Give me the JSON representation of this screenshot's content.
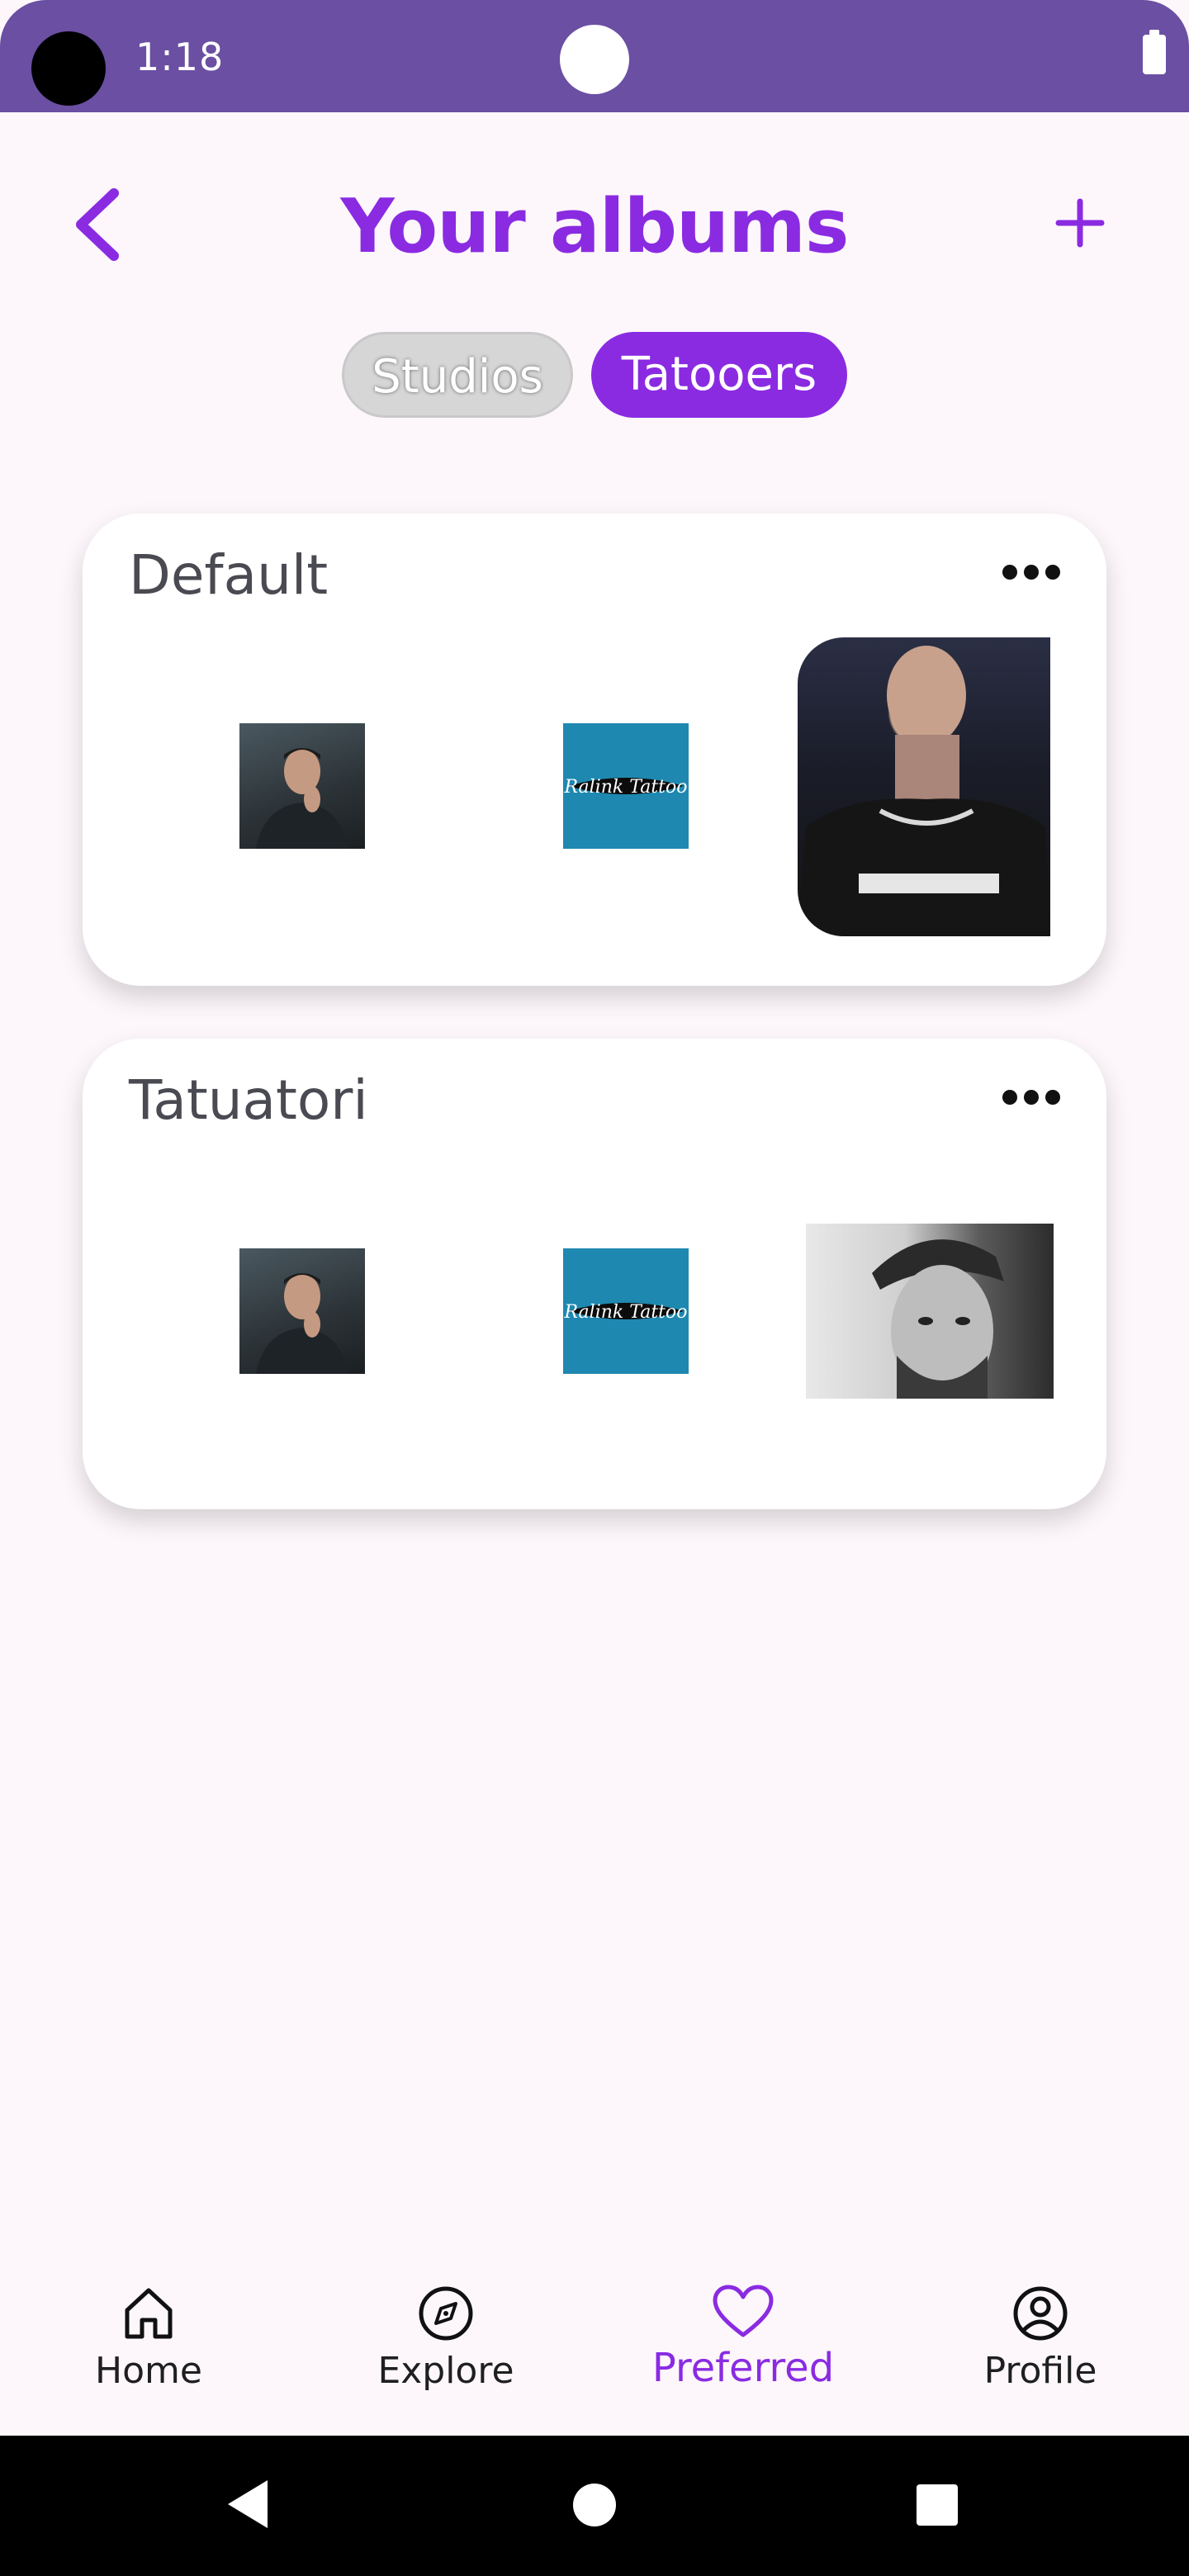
{
  "status_bar": {
    "time": "1:18"
  },
  "header": {
    "title": "Your albums"
  },
  "tabs": [
    {
      "label": "Studios",
      "selected": false
    },
    {
      "label": "Tatooers",
      "selected": true
    }
  ],
  "albums": [
    {
      "name": "Default",
      "thumb_logo_text": "Ralink Tattoo"
    },
    {
      "name": "Tatuatori",
      "thumb_logo_text": "Ralink Tattoo"
    }
  ],
  "bottom_nav": {
    "items": [
      {
        "label": "Home",
        "icon": "home-icon"
      },
      {
        "label": "Explore",
        "icon": "compass-icon"
      },
      {
        "label": "Preferred",
        "icon": "heart-icon"
      },
      {
        "label": "Profile",
        "icon": "user-circle-icon"
      }
    ],
    "active": "Preferred"
  },
  "colors": {
    "accent": "#8a2be2",
    "status_bar": "#6a4fa3",
    "background": "#fdf7fc"
  }
}
